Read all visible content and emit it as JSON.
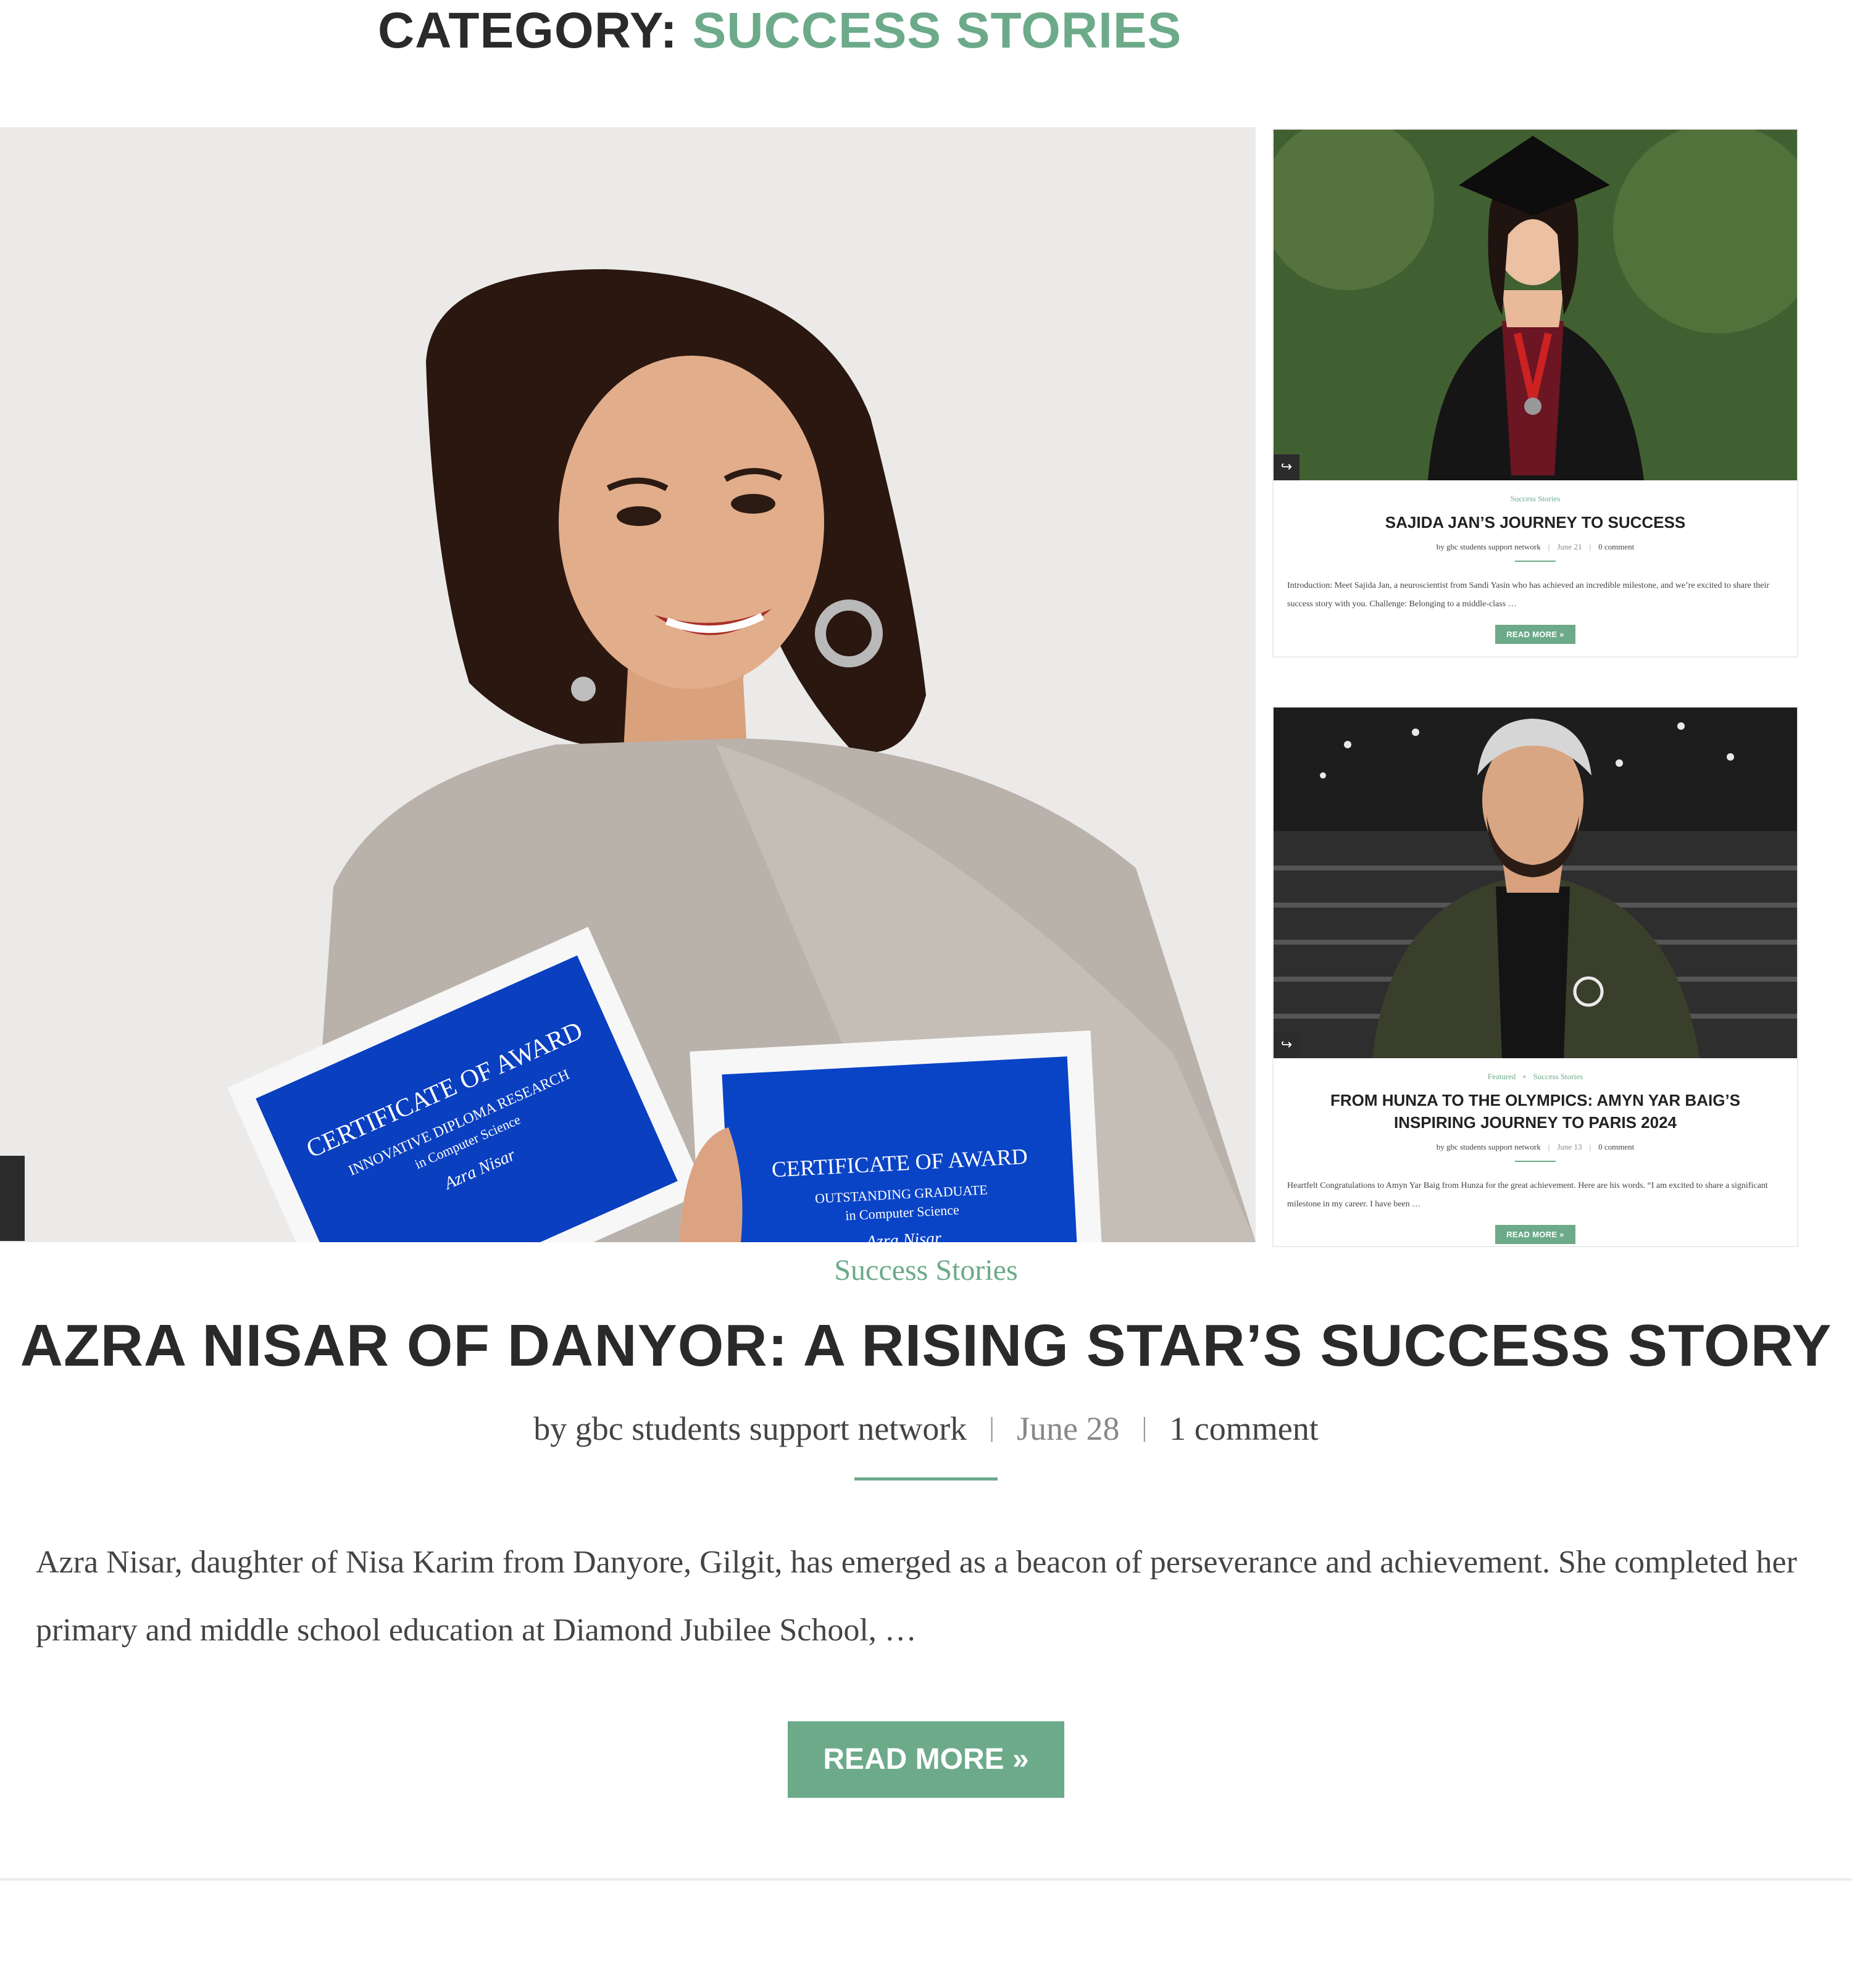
{
  "header": {
    "label": "CATEGORY:",
    "value": "SUCCESS STORIES"
  },
  "sidebar_posts": [
    {
      "category": "Success Stories",
      "title": "SAJIDA JAN’S JOURNEY TO SUCCESS",
      "author": "by gbc students support network",
      "date": "June 21",
      "comments": "0 comment",
      "excerpt": "Introduction: Meet Sajida Jan, a neuroscientist from Sandi Yasin who has achieved an incredible milestone, and we’re excited to share their success story with you. Challenge: Belonging to a middle-class …",
      "button": "READ MORE »"
    },
    {
      "category_1": "Featured",
      "category_2": "Success Stories",
      "title": "FROM HUNZA TO THE OLYMPICS: AMYN YAR BAIG’S INSPIRING JOURNEY TO PARIS 2024",
      "author": "by gbc students support network",
      "date": "June 13",
      "comments": "0 comment",
      "excerpt": "Heartfelt Congratulations to Amyn Yar Baig from Hunza for the great achievement. Here are his words. “I am excited to share a significant milestone in my career. I have been …",
      "button": "READ MORE »"
    }
  ],
  "main_post": {
    "category": "Success Stories",
    "title": "AZRA NISAR OF DANYOR: A RISING STAR’S SUCCESS STORY",
    "author": "by gbc students support network",
    "date": "June 28",
    "comments": "1 comment",
    "excerpt": "Azra Nisar, daughter of Nisa Karim from Danyore, Gilgit, has emerged as a beacon of perseverance and achievement. She completed her primary and middle school education at Diamond Jubilee School, …",
    "button": "READ MORE »"
  },
  "certificates": {
    "left": {
      "heading": "CERTIFICATE OF AWARD",
      "line1": "INNOVATIVE DIPLOMA RESEARCH",
      "line2": "in Computer Science",
      "name": "Azra Nisar"
    },
    "right": {
      "heading": "CERTIFICATE OF AWARD",
      "line1": "OUTSTANDING GRADUATE",
      "line2": "in Computer Science",
      "name": "Azra Nisar"
    }
  },
  "colors": {
    "accent": "#6caa8a",
    "heading": "#2a2a2a",
    "certificate_blue": "#0a3fbf"
  }
}
